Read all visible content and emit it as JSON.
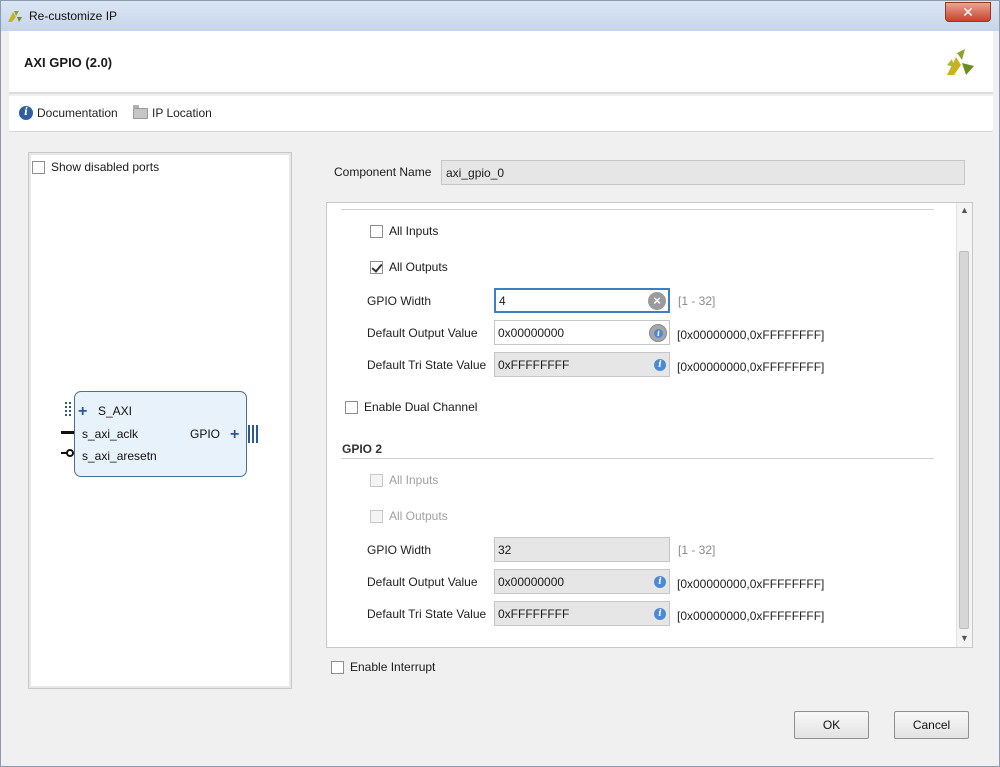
{
  "window": {
    "title": "Re-customize IP",
    "close_glyph": "✕"
  },
  "header": {
    "ip_title": "AXI GPIO (2.0)",
    "logo_icon": "vivado-logo-icon"
  },
  "doc_bar": {
    "documentation": "Documentation",
    "ip_location": "IP Location"
  },
  "left_panel": {
    "show_disabled_ports": {
      "label": "Show disabled ports",
      "checked": false
    },
    "block": {
      "ports_left": [
        "S_AXI",
        "s_axi_aclk",
        "s_axi_aresetn"
      ],
      "port_right": "GPIO"
    }
  },
  "component": {
    "label": "Component Name",
    "value": "axi_gpio_0"
  },
  "gpio1": {
    "all_inputs": {
      "label": "All Inputs",
      "checked": false
    },
    "all_outputs": {
      "label": "All Outputs",
      "checked": true
    },
    "width": {
      "label": "GPIO Width",
      "value": "4",
      "range": "[1 - 32]"
    },
    "default_output": {
      "label": "Default Output Value",
      "value": "0x00000000",
      "range": "[0x00000000,0xFFFFFFFF]"
    },
    "default_tri": {
      "label": "Default Tri State Value",
      "value": "0xFFFFFFFF",
      "range": "[0x00000000,0xFFFFFFFF]"
    }
  },
  "dual_channel": {
    "label": "Enable Dual Channel",
    "checked": false
  },
  "gpio2": {
    "title": "GPIO 2",
    "all_inputs": {
      "label": "All Inputs",
      "checked": false
    },
    "all_outputs": {
      "label": "All Outputs",
      "checked": false
    },
    "width": {
      "label": "GPIO Width",
      "value": "32",
      "range": "[1 - 32]"
    },
    "default_output": {
      "label": "Default Output Value",
      "value": "0x00000000",
      "range": "[0x00000000,0xFFFFFFFF]"
    },
    "default_tri": {
      "label": "Default Tri State Value",
      "value": "0xFFFFFFFF",
      "range": "[0x00000000,0xFFFFFFFF]"
    }
  },
  "interrupt": {
    "label": "Enable Interrupt",
    "checked": false
  },
  "buttons": {
    "ok": "OK",
    "cancel": "Cancel"
  },
  "colors": {
    "accent": "#3c7fc5",
    "block_fill": "#e8f2fb",
    "block_border": "#4b6f96"
  }
}
